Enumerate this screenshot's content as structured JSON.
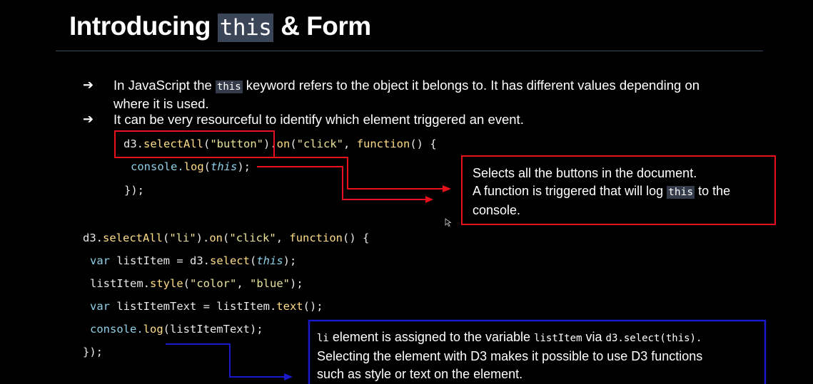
{
  "title": {
    "prefix": "Introducing",
    "code": "this",
    "suffix": "& Form"
  },
  "bullets": [
    {
      "arrow": "➔",
      "before": "In JavaScript the",
      "code": "this",
      "after": "keyword refers to the object it belongs to. It has different values depending on",
      "line2": "where it is used."
    },
    {
      "arrow": "➔",
      "text": "It can be very resourceful to identify which element triggered an event."
    }
  ],
  "code1": {
    "l1": {
      "a": "d3.",
      "b": "selectAll",
      "c": "(",
      "d": "\"button\"",
      "e": ").",
      "f": "on",
      "g": "(",
      "h": "\"click\"",
      "i": ", ",
      "j": "function",
      "k": "() {"
    },
    "l2": {
      "a": "console.",
      "b": "log",
      "c": "(",
      "d": "this",
      "e": ");"
    },
    "l3": "});"
  },
  "note1": {
    "line1": "Selects all the buttons in the document.",
    "line2_before": "A function is triggered that will log",
    "line2_code": "this",
    "line2_after": "to the",
    "line3": "console."
  },
  "code2": {
    "l1": {
      "a": "d3.",
      "b": "selectAll",
      "c": "(",
      "d": "\"li\"",
      "e": ").",
      "f": "on",
      "g": "(",
      "h": "\"click\"",
      "i": ", ",
      "j": "function",
      "k": "() {"
    },
    "l2": {
      "a": "var",
      "b": " listItem = d3.",
      "c": "select",
      "d": "(",
      "e": "this",
      "f": ");"
    },
    "l3": {
      "a": "listItem.",
      "b": "style",
      "c": "(",
      "d": "\"color\"",
      "e": ", ",
      "f": "\"blue\"",
      "g": ");"
    },
    "l4": {
      "a": "var",
      "b": " listItemText = listItem.",
      "c": "text",
      "d": "();"
    },
    "l5": {
      "a": "console.",
      "b": "log",
      "c": "(listItemText);"
    },
    "l6": "});"
  },
  "note2": {
    "code1": "li",
    "text1": "element is assigned to the variable",
    "code2": "listItem",
    "text2": "via",
    "code3": "d3.select(this).",
    "line2": "Selecting the element with D3 makes it possible to use D3 functions",
    "line3": "such as style or text on the element."
  },
  "colors": {
    "highlight_red": "#e8101a",
    "highlight_blue": "#1a1acd",
    "code_bg": "#3b4558",
    "rule": "#3a4a5e"
  }
}
